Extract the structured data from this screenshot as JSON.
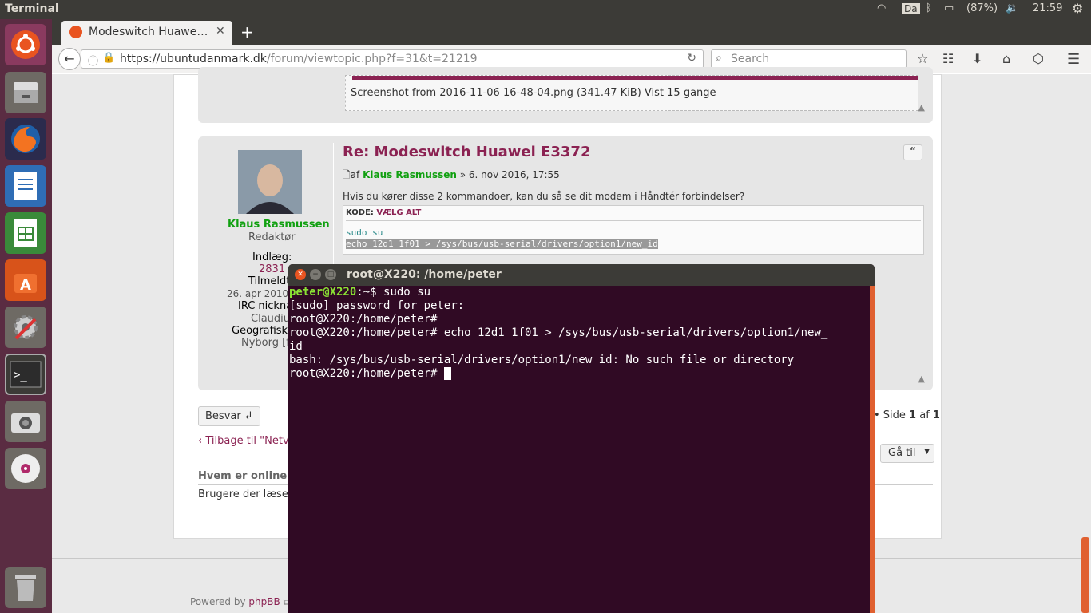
{
  "panel": {
    "app_title": "Terminal",
    "keyboard": "Da",
    "battery": "(87%)",
    "time": "21:59"
  },
  "browser": {
    "tab_title": "Modeswitch Huawe…",
    "new_tab": "+",
    "url_host": "https://ubuntudanmark.dk",
    "url_path": "/forum/viewtopic.php?f=31&t=21219",
    "search_placeholder": "Search"
  },
  "forum": {
    "attachment_caption": "Screenshot from 2016-11-06 16-48-04.png (341.47 KiB) Vist 15 gange",
    "post_title": "Re: Modeswitch Huawei E3372",
    "post_by_prefix": "af",
    "post_author": "Klaus Rasmussen",
    "post_date": "» 6. nov 2016, 17:55",
    "post_body": "Hvis du kører disse 2 kommandoer, kan du så se dit modem i Håndtér forbindelser?",
    "code_label": "KODE:",
    "code_select": "VÆLG ALT",
    "code_line1": "sudo su",
    "code_line2": "echo 12d1 1f01 > /sys/bus/usb-serial/drivers/option1/new_id",
    "profile_name": "Klaus Rasmussen",
    "profile_role": "Redaktør",
    "profile_posts_label": "Indlæg:",
    "profile_posts": "2831",
    "profile_joined_label": "Tilmeldt",
    "profile_joined": "26. apr 2010,",
    "profile_irc_label": "IRC nicknam",
    "profile_irc": "ClaudiuS",
    "profile_geo_label": "Geografisk s",
    "profile_geo": "Nyborg [fy",
    "reply_button": "Besvar",
    "pagination_prefix": "• Side ",
    "pagination_current": "1",
    "pagination_mid": " af ",
    "pagination_total": "1",
    "back_link": "Tilbage til \"Netva",
    "goto_button": "Gå til",
    "who_online": "Hvem er online",
    "users_reading": "Brugere der læser d",
    "powered_by": "Powered by ",
    "phpbb": "phpBB"
  },
  "terminal": {
    "title": "root@X220: /home/peter",
    "prompt_user": "peter@X220",
    "prompt_rest": ":~$ sudo su",
    "line2": "[sudo] password for peter:",
    "line3": "root@X220:/home/peter#",
    "line4": "root@X220:/home/peter# echo 12d1 1f01 > /sys/bus/usb-serial/drivers/option1/new_",
    "line5": "id",
    "line6": "bash: /sys/bus/usb-serial/drivers/option1/new_id: No such file or directory",
    "line7": "root@X220:/home/peter# "
  },
  "colors": {
    "terminal_bg": "#300a24",
    "launcher_bg": "#5a2c42",
    "accent_orange": "#e06030",
    "link_green": "#10a010",
    "post_title": "#8b2252"
  }
}
